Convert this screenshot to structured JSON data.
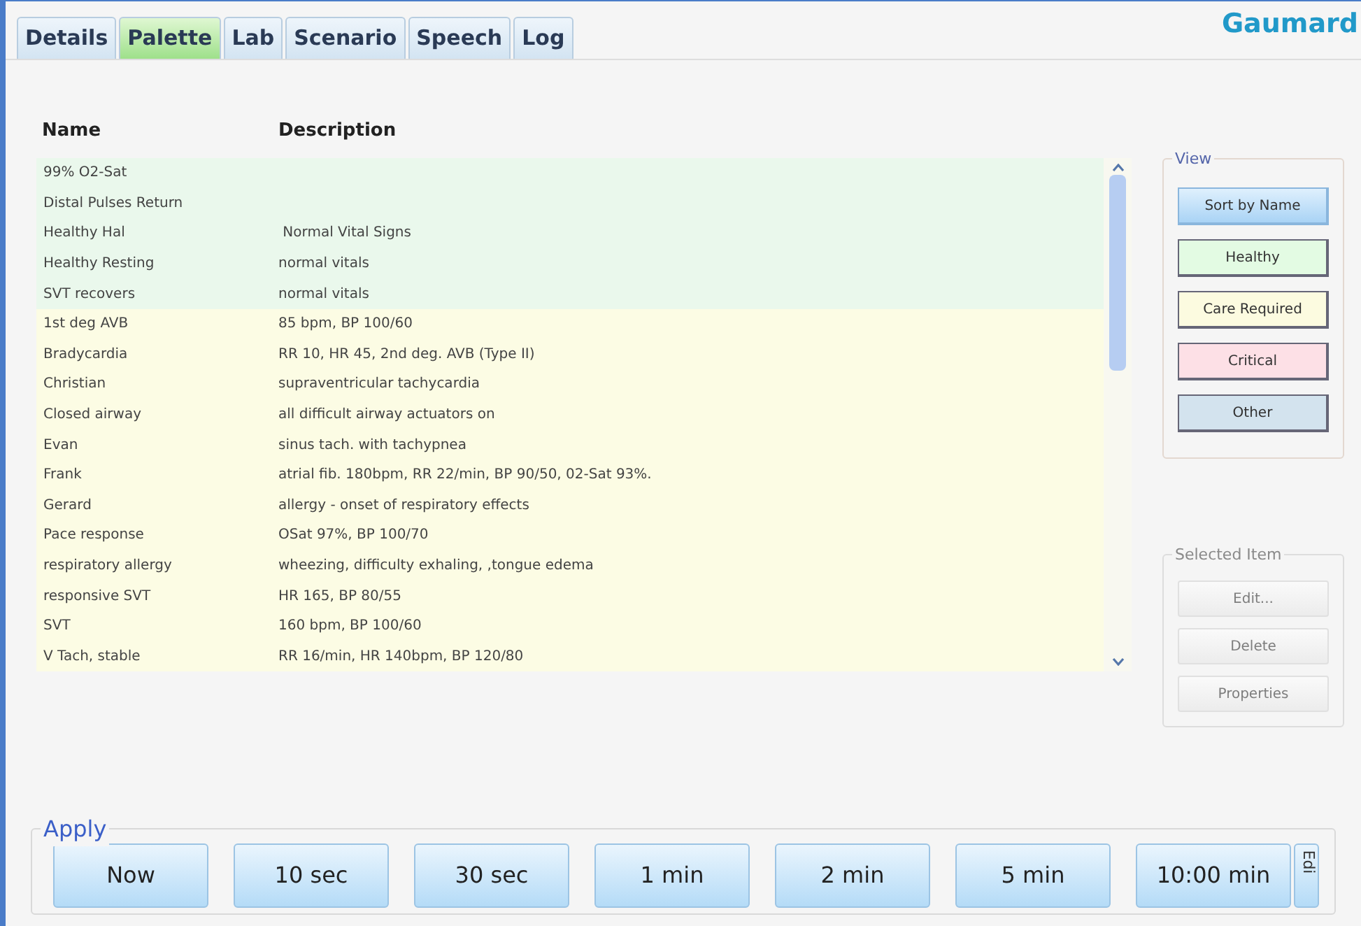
{
  "tabs": [
    {
      "label": "Details",
      "selected": false
    },
    {
      "label": "Palette",
      "selected": true
    },
    {
      "label": "Lab",
      "selected": false
    },
    {
      "label": "Scenario",
      "selected": false
    },
    {
      "label": "Speech",
      "selected": false
    },
    {
      "label": "Log",
      "selected": false
    }
  ],
  "logo": "Gaumard",
  "table": {
    "columns": [
      "Name",
      "Description"
    ],
    "rows": [
      {
        "name": "99% O2-Sat",
        "description": "",
        "kind": "healthy"
      },
      {
        "name": "Distal Pulses Return",
        "description": "",
        "kind": "healthy"
      },
      {
        "name": "Healthy Hal",
        "description": " Normal Vital Signs",
        "kind": "healthy"
      },
      {
        "name": "Healthy Resting",
        "description": "normal vitals",
        "kind": "healthy"
      },
      {
        "name": "SVT recovers",
        "description": "normal vitals",
        "kind": "healthy"
      },
      {
        "name": "1st deg AVB",
        "description": "85 bpm, BP 100/60",
        "kind": "care"
      },
      {
        "name": "Bradycardia",
        "description": "RR 10, HR 45, 2nd deg. AVB (Type II)",
        "kind": "care"
      },
      {
        "name": "Christian",
        "description": "supraventricular tachycardia",
        "kind": "care"
      },
      {
        "name": "Closed airway",
        "description": "all difficult airway actuators on",
        "kind": "care"
      },
      {
        "name": "Evan",
        "description": "sinus tach. with tachypnea",
        "kind": "care"
      },
      {
        "name": "Frank",
        "description": "atrial fib. 180bpm, RR 22/min, BP 90/50, 02-Sat 93%.",
        "kind": "care"
      },
      {
        "name": "Gerard",
        "description": "allergy - onset of respiratory effects",
        "kind": "care"
      },
      {
        "name": "Pace response",
        "description": "OSat 97%, BP 100/70",
        "kind": "care"
      },
      {
        "name": "respiratory allergy",
        "description": "wheezing, difficulty exhaling, ,tongue edema",
        "kind": "care"
      },
      {
        "name": "responsive SVT",
        "description": "HR 165, BP 80/55",
        "kind": "care"
      },
      {
        "name": "SVT",
        "description": "160 bpm, BP 100/60",
        "kind": "care"
      },
      {
        "name": "V Tach, stable",
        "description": "RR 16/min, HR 140bpm, BP 120/80",
        "kind": "care"
      }
    ]
  },
  "view": {
    "title": "View",
    "buttons": [
      {
        "label": "Sort by Name",
        "kind": "sort"
      },
      {
        "label": "Healthy",
        "kind": "healthy"
      },
      {
        "label": "Care Required",
        "kind": "care"
      },
      {
        "label": "Critical",
        "kind": "critical"
      },
      {
        "label": "Other",
        "kind": "other"
      }
    ]
  },
  "selected_item": {
    "title": "Selected Item",
    "disabled": true,
    "buttons": [
      "Edit...",
      "Delete",
      "Properties"
    ]
  },
  "apply": {
    "title": "Apply",
    "buttons": [
      "Now",
      "10 sec",
      "30 sec",
      "1 min",
      "2 min",
      "5 min",
      "10:00 min"
    ],
    "side_button": "Edi"
  }
}
